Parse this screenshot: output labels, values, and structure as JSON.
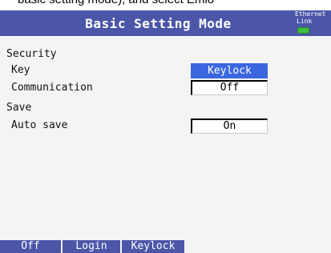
{
  "doc_caption": "basic setting mode), and select Emlo",
  "title": "Basic Setting Mode",
  "status": {
    "ethernet_label": "Ethernet",
    "link_label": "Link",
    "led_color": "#3fbf3f"
  },
  "sections": {
    "security": {
      "heading": "Security",
      "key_label": "Key",
      "key_value": "Keylock",
      "communication_label": "Communication",
      "communication_value": "Off"
    },
    "save": {
      "heading": "Save",
      "auto_save_label": "Auto save",
      "auto_save_value": "On"
    }
  },
  "softkeys": [
    "Off",
    "Login",
    "Keylock"
  ],
  "colors": {
    "title_bar": "#4b56a8",
    "selected_field": "#3a66e0",
    "screen_bg": "#f4f4f4"
  }
}
